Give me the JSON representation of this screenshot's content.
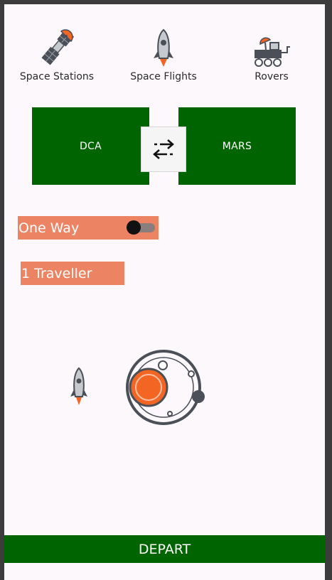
{
  "categories": [
    {
      "label": "Space Stations",
      "icon": "satellite-icon"
    },
    {
      "label": "Space Flights",
      "icon": "rocket-icon"
    },
    {
      "label": "Rovers",
      "icon": "rover-icon"
    }
  ],
  "route": {
    "origin": "DCA",
    "destination": "MARS",
    "swap_icon": "swap-arrows-icon"
  },
  "trip_type": {
    "label": "One Way",
    "toggle_on": false
  },
  "travellers": {
    "label": "1 Traveller"
  },
  "illustration": {
    "rocket_icon": "rocket-icon",
    "planet_icon": "planet-orbit-icon"
  },
  "actions": {
    "depart_label": "DEPART"
  },
  "colors": {
    "primary": "#006400",
    "accent": "#ec8464",
    "planet": "#f26522",
    "icon_dark": "#4a4f58",
    "background": "#fdf8fc"
  }
}
